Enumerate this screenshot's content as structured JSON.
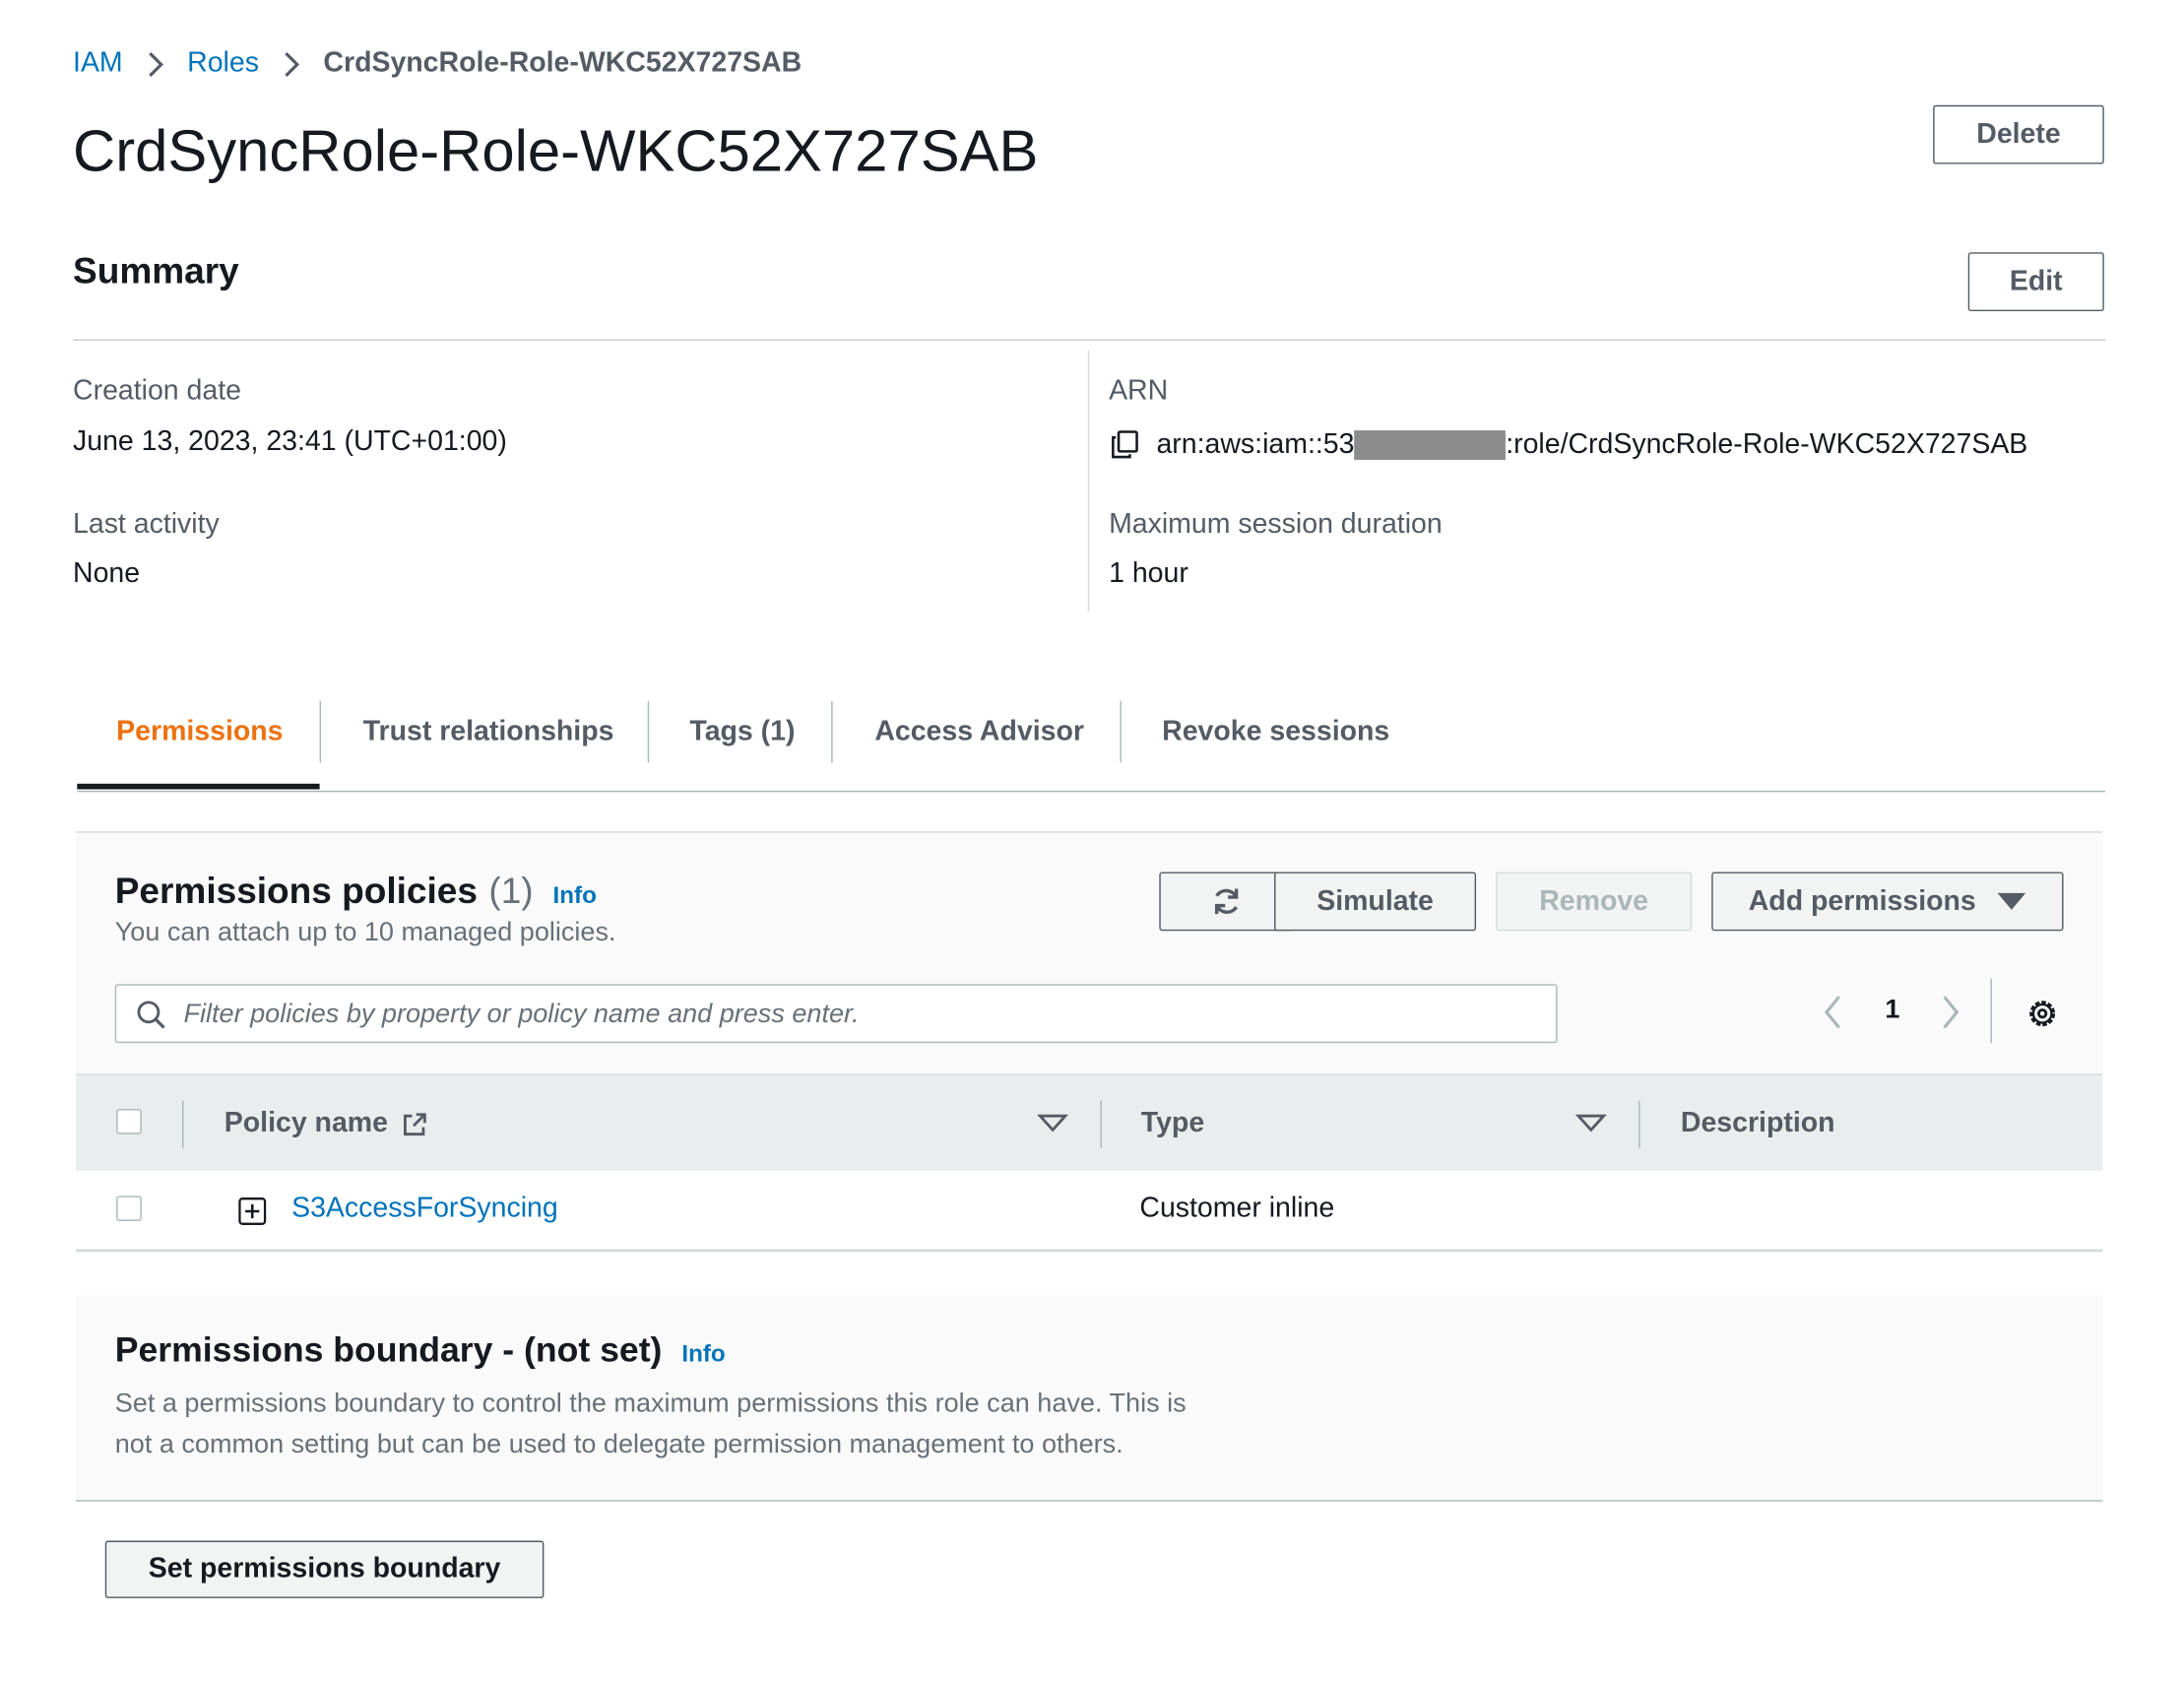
{
  "breadcrumb": {
    "root": "IAM",
    "section": "Roles",
    "current": "CrdSyncRole-Role-WKC52X727SAB"
  },
  "page": {
    "title": "CrdSyncRole-Role-WKC52X727SAB",
    "delete_label": "Delete"
  },
  "summary": {
    "title": "Summary",
    "edit_label": "Edit",
    "creation_date_label": "Creation date",
    "creation_date": "June 13, 2023, 23:41 (UTC+01:00)",
    "last_activity_label": "Last activity",
    "last_activity": "None",
    "arn_label": "ARN",
    "arn_prefix": "arn:aws:iam::53",
    "arn_suffix": ":role/CrdSyncRole-Role-WKC52X727SAB",
    "max_session_label": "Maximum session duration",
    "max_session": "1 hour"
  },
  "tabs": [
    {
      "label": "Permissions",
      "active": true
    },
    {
      "label": "Trust relationships"
    },
    {
      "label": "Tags (1)"
    },
    {
      "label": "Access Advisor"
    },
    {
      "label": "Revoke sessions"
    }
  ],
  "policies": {
    "title": "Permissions policies",
    "count": "(1)",
    "info": "Info",
    "subtitle": "You can attach up to 10 managed policies.",
    "simulate_label": "Simulate",
    "remove_label": "Remove",
    "add_label": "Add permissions",
    "search_placeholder": "Filter policies by property or policy name and press enter.",
    "page": "1",
    "columns": [
      "Policy name",
      "Type",
      "Description"
    ],
    "rows": [
      {
        "name": "S3AccessForSyncing",
        "type": "Customer inline",
        "description": ""
      }
    ]
  },
  "boundary": {
    "title": "Permissions boundary - (not set)",
    "info": "Info",
    "desc_line1": "Set a permissions boundary to control the maximum permissions this role can have. This is",
    "desc_line2": "not a common setting but can be used to delegate permission management to others.",
    "set_label": "Set permissions boundary"
  },
  "colors": {
    "link": "#0073bb",
    "active_tab": "#ec7211",
    "text": "#16191f",
    "muted": "#545b64"
  },
  "icons": [
    "chevron-right-icon",
    "copy-icon",
    "refresh-icon",
    "caret-down-icon",
    "search-icon",
    "chevron-left-icon",
    "gear-icon",
    "external-link-icon",
    "expand-icon",
    "sort-icon"
  ]
}
